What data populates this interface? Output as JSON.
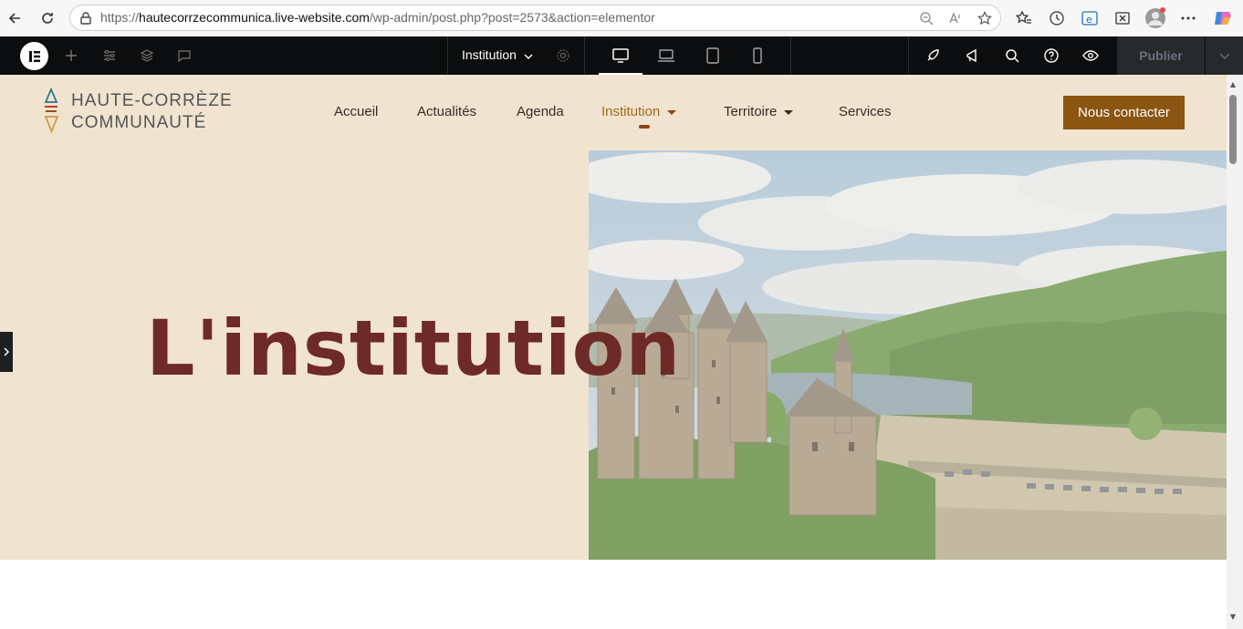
{
  "browser": {
    "url_prefix": "https://",
    "url_host": "hautecorrzecommunica.live-website.com",
    "url_path": "/wp-admin/post.php?post=2573&action=elementor",
    "icons": [
      "back-icon",
      "refresh-icon",
      "lock-icon",
      "zoom-out-icon",
      "read-aloud-icon",
      "favorite-icon",
      "favorites-icon",
      "history-icon",
      "ie-mode-icon",
      "screenshot-icon",
      "profile-avatar",
      "more-icon",
      "copilot-icon"
    ]
  },
  "editor": {
    "page_name": "Institution",
    "publish_label": "Publier",
    "icons": [
      "elementor-logo",
      "add-icon",
      "settings-icon",
      "layers-icon",
      "comments-icon",
      "page-settings-icon",
      "desktop-icon",
      "laptop-icon",
      "tablet-icon",
      "mobile-icon",
      "launch-icon",
      "whats-new-icon",
      "search-icon",
      "help-icon",
      "preview-icon",
      "chevron-down-icon"
    ],
    "active_device": "desktop"
  },
  "site": {
    "logo_line1": "HAUTE-CORRÈZE",
    "logo_line2": "COMMUNAUTÉ",
    "nav": [
      {
        "label": "Accueil",
        "active": false
      },
      {
        "label": "Actualités",
        "active": false
      },
      {
        "label": "Agenda",
        "active": false
      },
      {
        "label": "Institution",
        "active": true,
        "dropdown": true
      },
      {
        "label": "Territoire",
        "active": false,
        "dropdown": true
      },
      {
        "label": "Services",
        "active": false
      }
    ],
    "cta_label": "Nous contacter",
    "hero_title": "L'institution"
  },
  "colors": {
    "header_bg": "#f0e3d0",
    "accent": "#8b5512",
    "title": "#6e2a27",
    "editor_bg": "#0c0d0e"
  }
}
